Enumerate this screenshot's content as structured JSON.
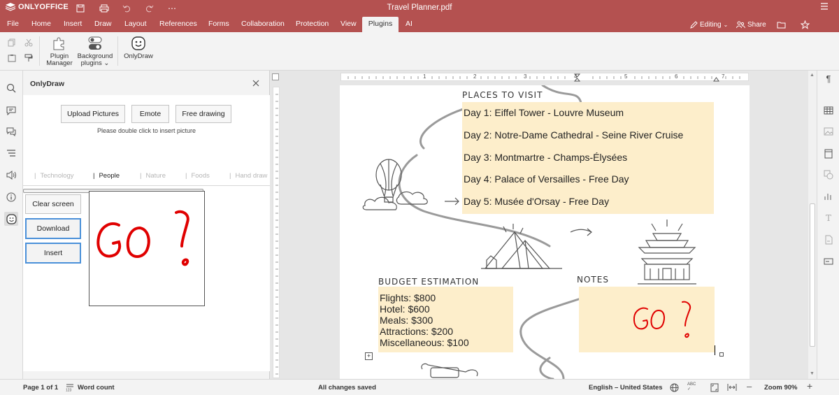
{
  "app": {
    "brand": "ONLYOFFICE",
    "doc_title": "Travel Planner.pdf",
    "more_label": "⋯"
  },
  "menu": {
    "tabs": [
      {
        "label": "File"
      },
      {
        "label": "Home"
      },
      {
        "label": "Insert"
      },
      {
        "label": "Draw"
      },
      {
        "label": "Layout"
      },
      {
        "label": "References"
      },
      {
        "label": "Forms"
      },
      {
        "label": "Collaboration"
      },
      {
        "label": "Protection"
      },
      {
        "label": "View"
      },
      {
        "label": "Plugins"
      },
      {
        "label": "AI"
      }
    ],
    "active_tab": "Plugins",
    "editing_label": "Editing",
    "share_label": "Share"
  },
  "toolbar": {
    "plugin_manager_label_1": "Plugin",
    "plugin_manager_label_2": "Manager",
    "background_plugins_label_1": "Background",
    "background_plugins_label_2": "plugins ⌄",
    "onlydraw_label": "OnlyDraw"
  },
  "plugin_panel": {
    "title": "OnlyDraw",
    "upload_label": "Upload Pictures",
    "emote_label": "Emote",
    "free_drawing_label": "Free drawing",
    "hint": "Please double click to insert picture",
    "categories": [
      {
        "label": "Technology"
      },
      {
        "label": "People"
      },
      {
        "label": "Nature"
      },
      {
        "label": "Foods"
      },
      {
        "label": "Hand draw"
      }
    ],
    "selected_category": "People",
    "clear_label": "Clear screen",
    "download_label": "Download",
    "insert_label": "Insert",
    "brush_color": "#ff0000",
    "brush_size": 0.35,
    "canvas_text": "GO!"
  },
  "document": {
    "places_title": "PLACES TO VISIT",
    "days": [
      "Day 1: Eiffel Tower - Louvre Museum",
      "Day 2: Notre-Dame Cathedral - Seine River Cruise",
      "Day 3: Montmartre - Champs-Élysées",
      "Day 4: Palace of Versailles - Free Day",
      "Day 5: Musée d'Orsay - Free Day"
    ],
    "budget_title": "BUDGET ESTIMATION",
    "budget": [
      "Flights: $800",
      "Hotel: $600",
      "Meals: $300",
      "Attractions: $200",
      "Miscellaneous: $100"
    ],
    "notes_title": "NOTES",
    "notes_drawing": "GO!",
    "note_color": "#fdeecb",
    "ruler_numbers": [
      "1",
      "2",
      "3",
      "4",
      "5",
      "6",
      "7"
    ]
  },
  "status": {
    "page": "Page 1 of 1",
    "word_count": "Word count",
    "saved": "All changes saved",
    "language": "English – United States",
    "zoom": "Zoom 90%"
  },
  "colors": {
    "accent": "#b45150",
    "drawing": "#e00000",
    "focus": "#4a90d9"
  }
}
